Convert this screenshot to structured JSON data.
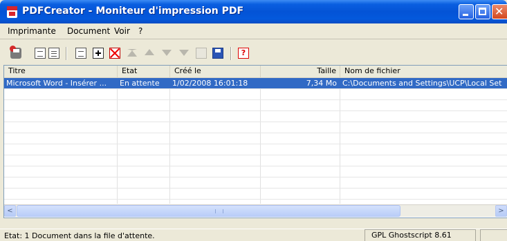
{
  "window": {
    "title": "PDFCreator - Moniteur d'impression PDF"
  },
  "menu": [
    "Imprimante",
    "Document",
    "Voir",
    "?"
  ],
  "toolbar": {
    "icons": [
      "printer-icon",
      "document-icon",
      "document-list-icon",
      "new-document-icon",
      "add-document-icon",
      "delete-document-icon",
      "move-top-icon",
      "move-up-icon",
      "move-down-icon",
      "move-bottom-icon",
      "copy-icon",
      "save-icon",
      "help-icon"
    ],
    "help_label": "?"
  },
  "table": {
    "columns": [
      "Titre",
      "Etat",
      "Créé le",
      "Taille",
      "Nom de fichier"
    ],
    "rows": [
      {
        "titre": "Microsoft Word - Insérer ...",
        "etat": "En attente",
        "cree": "1/02/2008 16:01:18",
        "taille": "7,34 Mo",
        "fichier": "C:\\Documents and Settings\\UCP\\Local Set"
      }
    ]
  },
  "statusbar": {
    "left": "Etat: 1 Document dans la file d'attente.",
    "right": "GPL Ghostscript 8.61"
  },
  "colors": {
    "titlebar": "#0453d6",
    "selection": "#316ac5",
    "window": "#ece9d8"
  }
}
